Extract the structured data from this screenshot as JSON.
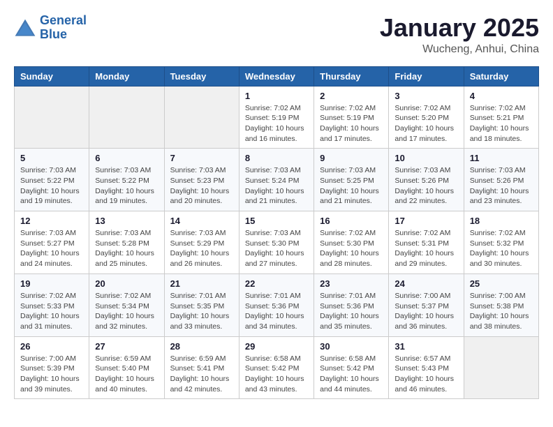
{
  "header": {
    "logo_line1": "General",
    "logo_line2": "Blue",
    "title": "January 2025",
    "subtitle": "Wucheng, Anhui, China"
  },
  "weekdays": [
    "Sunday",
    "Monday",
    "Tuesday",
    "Wednesday",
    "Thursday",
    "Friday",
    "Saturday"
  ],
  "weeks": [
    [
      {
        "day": "",
        "info": ""
      },
      {
        "day": "",
        "info": ""
      },
      {
        "day": "",
        "info": ""
      },
      {
        "day": "1",
        "info": "Sunrise: 7:02 AM\nSunset: 5:19 PM\nDaylight: 10 hours\nand 16 minutes."
      },
      {
        "day": "2",
        "info": "Sunrise: 7:02 AM\nSunset: 5:19 PM\nDaylight: 10 hours\nand 17 minutes."
      },
      {
        "day": "3",
        "info": "Sunrise: 7:02 AM\nSunset: 5:20 PM\nDaylight: 10 hours\nand 17 minutes."
      },
      {
        "day": "4",
        "info": "Sunrise: 7:02 AM\nSunset: 5:21 PM\nDaylight: 10 hours\nand 18 minutes."
      }
    ],
    [
      {
        "day": "5",
        "info": "Sunrise: 7:03 AM\nSunset: 5:22 PM\nDaylight: 10 hours\nand 19 minutes."
      },
      {
        "day": "6",
        "info": "Sunrise: 7:03 AM\nSunset: 5:22 PM\nDaylight: 10 hours\nand 19 minutes."
      },
      {
        "day": "7",
        "info": "Sunrise: 7:03 AM\nSunset: 5:23 PM\nDaylight: 10 hours\nand 20 minutes."
      },
      {
        "day": "8",
        "info": "Sunrise: 7:03 AM\nSunset: 5:24 PM\nDaylight: 10 hours\nand 21 minutes."
      },
      {
        "day": "9",
        "info": "Sunrise: 7:03 AM\nSunset: 5:25 PM\nDaylight: 10 hours\nand 21 minutes."
      },
      {
        "day": "10",
        "info": "Sunrise: 7:03 AM\nSunset: 5:26 PM\nDaylight: 10 hours\nand 22 minutes."
      },
      {
        "day": "11",
        "info": "Sunrise: 7:03 AM\nSunset: 5:26 PM\nDaylight: 10 hours\nand 23 minutes."
      }
    ],
    [
      {
        "day": "12",
        "info": "Sunrise: 7:03 AM\nSunset: 5:27 PM\nDaylight: 10 hours\nand 24 minutes."
      },
      {
        "day": "13",
        "info": "Sunrise: 7:03 AM\nSunset: 5:28 PM\nDaylight: 10 hours\nand 25 minutes."
      },
      {
        "day": "14",
        "info": "Sunrise: 7:03 AM\nSunset: 5:29 PM\nDaylight: 10 hours\nand 26 minutes."
      },
      {
        "day": "15",
        "info": "Sunrise: 7:03 AM\nSunset: 5:30 PM\nDaylight: 10 hours\nand 27 minutes."
      },
      {
        "day": "16",
        "info": "Sunrise: 7:02 AM\nSunset: 5:30 PM\nDaylight: 10 hours\nand 28 minutes."
      },
      {
        "day": "17",
        "info": "Sunrise: 7:02 AM\nSunset: 5:31 PM\nDaylight: 10 hours\nand 29 minutes."
      },
      {
        "day": "18",
        "info": "Sunrise: 7:02 AM\nSunset: 5:32 PM\nDaylight: 10 hours\nand 30 minutes."
      }
    ],
    [
      {
        "day": "19",
        "info": "Sunrise: 7:02 AM\nSunset: 5:33 PM\nDaylight: 10 hours\nand 31 minutes."
      },
      {
        "day": "20",
        "info": "Sunrise: 7:02 AM\nSunset: 5:34 PM\nDaylight: 10 hours\nand 32 minutes."
      },
      {
        "day": "21",
        "info": "Sunrise: 7:01 AM\nSunset: 5:35 PM\nDaylight: 10 hours\nand 33 minutes."
      },
      {
        "day": "22",
        "info": "Sunrise: 7:01 AM\nSunset: 5:36 PM\nDaylight: 10 hours\nand 34 minutes."
      },
      {
        "day": "23",
        "info": "Sunrise: 7:01 AM\nSunset: 5:36 PM\nDaylight: 10 hours\nand 35 minutes."
      },
      {
        "day": "24",
        "info": "Sunrise: 7:00 AM\nSunset: 5:37 PM\nDaylight: 10 hours\nand 36 minutes."
      },
      {
        "day": "25",
        "info": "Sunrise: 7:00 AM\nSunset: 5:38 PM\nDaylight: 10 hours\nand 38 minutes."
      }
    ],
    [
      {
        "day": "26",
        "info": "Sunrise: 7:00 AM\nSunset: 5:39 PM\nDaylight: 10 hours\nand 39 minutes."
      },
      {
        "day": "27",
        "info": "Sunrise: 6:59 AM\nSunset: 5:40 PM\nDaylight: 10 hours\nand 40 minutes."
      },
      {
        "day": "28",
        "info": "Sunrise: 6:59 AM\nSunset: 5:41 PM\nDaylight: 10 hours\nand 42 minutes."
      },
      {
        "day": "29",
        "info": "Sunrise: 6:58 AM\nSunset: 5:42 PM\nDaylight: 10 hours\nand 43 minutes."
      },
      {
        "day": "30",
        "info": "Sunrise: 6:58 AM\nSunset: 5:42 PM\nDaylight: 10 hours\nand 44 minutes."
      },
      {
        "day": "31",
        "info": "Sunrise: 6:57 AM\nSunset: 5:43 PM\nDaylight: 10 hours\nand 46 minutes."
      },
      {
        "day": "",
        "info": ""
      }
    ]
  ]
}
